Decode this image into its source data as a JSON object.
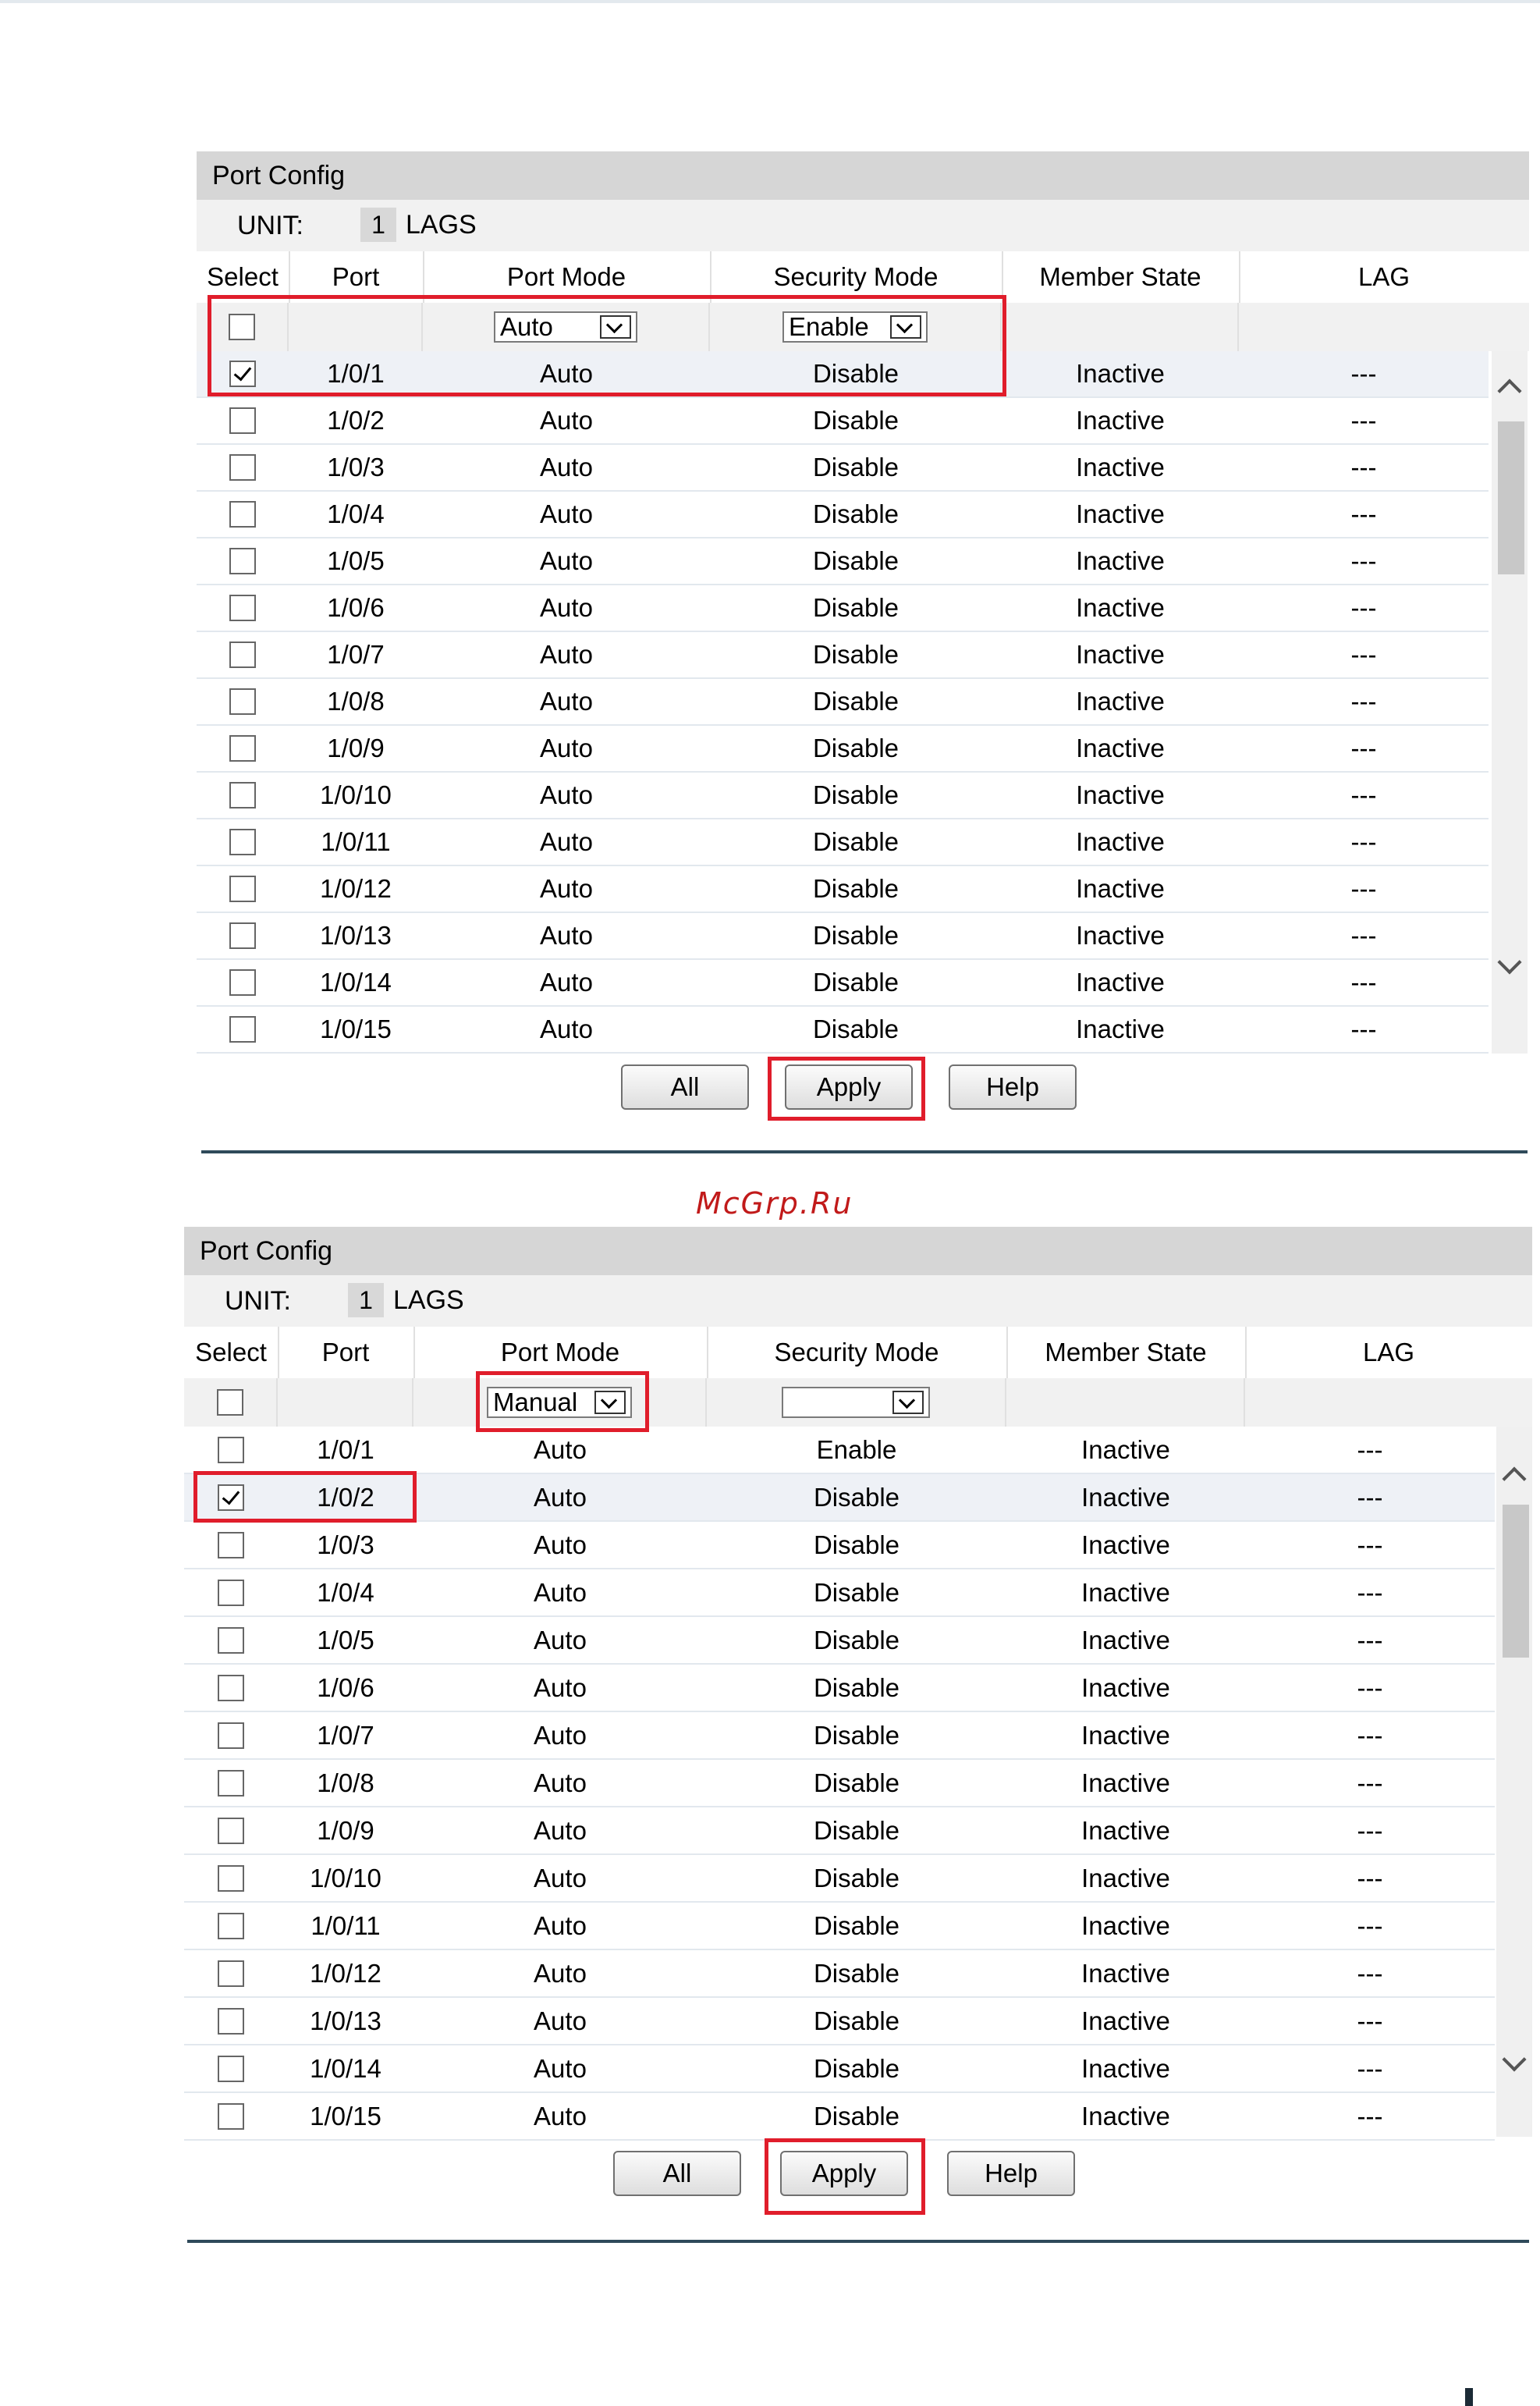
{
  "watermark": "McGrp.Ru",
  "panels": [
    {
      "title": "Port Config",
      "unit_label": "UNIT:",
      "unit_value": "1",
      "lags_label": "LAGS",
      "headers": [
        "Select",
        "Port",
        "Port Mode",
        "Security Mode",
        "Member State",
        "LAG"
      ],
      "filter": {
        "port_mode": "Auto",
        "security_mode": "Enable"
      },
      "rows": [
        {
          "checked": true,
          "port": "1/0/1",
          "port_mode": "Auto",
          "security_mode": "Disable",
          "member_state": "Inactive",
          "lag": "---"
        },
        {
          "checked": false,
          "port": "1/0/2",
          "port_mode": "Auto",
          "security_mode": "Disable",
          "member_state": "Inactive",
          "lag": "---"
        },
        {
          "checked": false,
          "port": "1/0/3",
          "port_mode": "Auto",
          "security_mode": "Disable",
          "member_state": "Inactive",
          "lag": "---"
        },
        {
          "checked": false,
          "port": "1/0/4",
          "port_mode": "Auto",
          "security_mode": "Disable",
          "member_state": "Inactive",
          "lag": "---"
        },
        {
          "checked": false,
          "port": "1/0/5",
          "port_mode": "Auto",
          "security_mode": "Disable",
          "member_state": "Inactive",
          "lag": "---"
        },
        {
          "checked": false,
          "port": "1/0/6",
          "port_mode": "Auto",
          "security_mode": "Disable",
          "member_state": "Inactive",
          "lag": "---"
        },
        {
          "checked": false,
          "port": "1/0/7",
          "port_mode": "Auto",
          "security_mode": "Disable",
          "member_state": "Inactive",
          "lag": "---"
        },
        {
          "checked": false,
          "port": "1/0/8",
          "port_mode": "Auto",
          "security_mode": "Disable",
          "member_state": "Inactive",
          "lag": "---"
        },
        {
          "checked": false,
          "port": "1/0/9",
          "port_mode": "Auto",
          "security_mode": "Disable",
          "member_state": "Inactive",
          "lag": "---"
        },
        {
          "checked": false,
          "port": "1/0/10",
          "port_mode": "Auto",
          "security_mode": "Disable",
          "member_state": "Inactive",
          "lag": "---"
        },
        {
          "checked": false,
          "port": "1/0/11",
          "port_mode": "Auto",
          "security_mode": "Disable",
          "member_state": "Inactive",
          "lag": "---"
        },
        {
          "checked": false,
          "port": "1/0/12",
          "port_mode": "Auto",
          "security_mode": "Disable",
          "member_state": "Inactive",
          "lag": "---"
        },
        {
          "checked": false,
          "port": "1/0/13",
          "port_mode": "Auto",
          "security_mode": "Disable",
          "member_state": "Inactive",
          "lag": "---"
        },
        {
          "checked": false,
          "port": "1/0/14",
          "port_mode": "Auto",
          "security_mode": "Disable",
          "member_state": "Inactive",
          "lag": "---"
        },
        {
          "checked": false,
          "port": "1/0/15",
          "port_mode": "Auto",
          "security_mode": "Disable",
          "member_state": "Inactive",
          "lag": "---"
        }
      ],
      "buttons": {
        "all": "All",
        "apply": "Apply",
        "help": "Help"
      }
    },
    {
      "title": "Port Config",
      "unit_label": "UNIT:",
      "unit_value": "1",
      "lags_label": "LAGS",
      "headers": [
        "Select",
        "Port",
        "Port Mode",
        "Security Mode",
        "Member State",
        "LAG"
      ],
      "filter": {
        "port_mode": "Manual",
        "security_mode": ""
      },
      "rows": [
        {
          "checked": false,
          "port": "1/0/1",
          "port_mode": "Auto",
          "security_mode": "Enable",
          "member_state": "Inactive",
          "lag": "---"
        },
        {
          "checked": true,
          "port": "1/0/2",
          "port_mode": "Auto",
          "security_mode": "Disable",
          "member_state": "Inactive",
          "lag": "---"
        },
        {
          "checked": false,
          "port": "1/0/3",
          "port_mode": "Auto",
          "security_mode": "Disable",
          "member_state": "Inactive",
          "lag": "---"
        },
        {
          "checked": false,
          "port": "1/0/4",
          "port_mode": "Auto",
          "security_mode": "Disable",
          "member_state": "Inactive",
          "lag": "---"
        },
        {
          "checked": false,
          "port": "1/0/5",
          "port_mode": "Auto",
          "security_mode": "Disable",
          "member_state": "Inactive",
          "lag": "---"
        },
        {
          "checked": false,
          "port": "1/0/6",
          "port_mode": "Auto",
          "security_mode": "Disable",
          "member_state": "Inactive",
          "lag": "---"
        },
        {
          "checked": false,
          "port": "1/0/7",
          "port_mode": "Auto",
          "security_mode": "Disable",
          "member_state": "Inactive",
          "lag": "---"
        },
        {
          "checked": false,
          "port": "1/0/8",
          "port_mode": "Auto",
          "security_mode": "Disable",
          "member_state": "Inactive",
          "lag": "---"
        },
        {
          "checked": false,
          "port": "1/0/9",
          "port_mode": "Auto",
          "security_mode": "Disable",
          "member_state": "Inactive",
          "lag": "---"
        },
        {
          "checked": false,
          "port": "1/0/10",
          "port_mode": "Auto",
          "security_mode": "Disable",
          "member_state": "Inactive",
          "lag": "---"
        },
        {
          "checked": false,
          "port": "1/0/11",
          "port_mode": "Auto",
          "security_mode": "Disable",
          "member_state": "Inactive",
          "lag": "---"
        },
        {
          "checked": false,
          "port": "1/0/12",
          "port_mode": "Auto",
          "security_mode": "Disable",
          "member_state": "Inactive",
          "lag": "---"
        },
        {
          "checked": false,
          "port": "1/0/13",
          "port_mode": "Auto",
          "security_mode": "Disable",
          "member_state": "Inactive",
          "lag": "---"
        },
        {
          "checked": false,
          "port": "1/0/14",
          "port_mode": "Auto",
          "security_mode": "Disable",
          "member_state": "Inactive",
          "lag": "---"
        },
        {
          "checked": false,
          "port": "1/0/15",
          "port_mode": "Auto",
          "security_mode": "Disable",
          "member_state": "Inactive",
          "lag": "---"
        }
      ],
      "buttons": {
        "all": "All",
        "apply": "Apply",
        "help": "Help"
      }
    }
  ]
}
